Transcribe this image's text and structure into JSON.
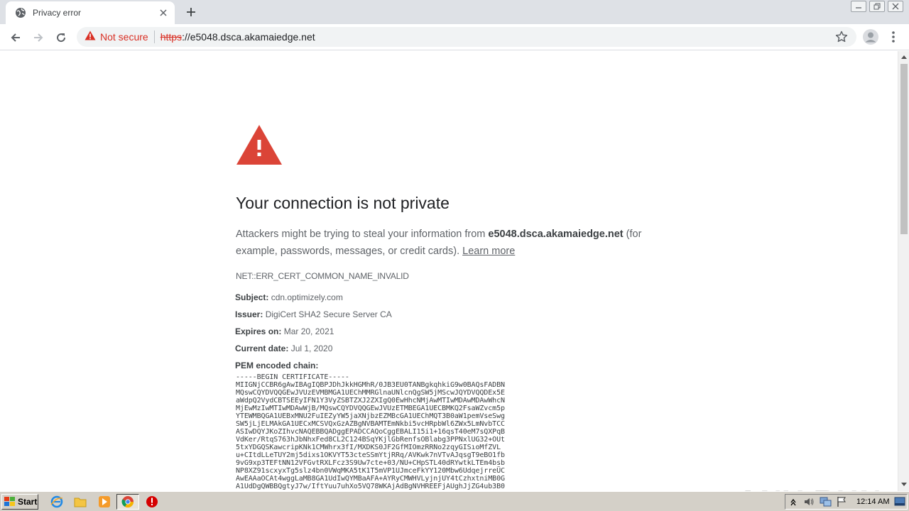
{
  "tab": {
    "title": "Privacy error"
  },
  "omnibox": {
    "security_label": "Not secure",
    "url_scheme": "https",
    "url_rest": "://e5048.dsca.akamaiedge.net"
  },
  "page": {
    "heading": "Your connection is not private",
    "para_prefix": "Attackers might be trying to steal your information from ",
    "domain": "e5048.dsca.akamaiedge.net",
    "para_suffix": " (for example, passwords, messages, or credit cards). ",
    "learn_more": "Learn more",
    "error_code": "NET::ERR_CERT_COMMON_NAME_INVALID",
    "subject_key": "Subject:",
    "subject_value": "cdn.optimizely.com",
    "issuer_key": "Issuer:",
    "issuer_value": "DigiCert SHA2 Secure Server CA",
    "expires_key": "Expires on:",
    "expires_value": "Mar 20, 2021",
    "current_key": "Current date:",
    "current_value": "Jul 1, 2020",
    "pem_key": "PEM encoded chain:",
    "pem_text": "-----BEGIN CERTIFICATE-----\nMIIGNjCCBR6gAwIBAgIQBPJDhJkkHGMhR/0JB3EU0TANBgkqhkiG9w0BAQsFADBN\nMQswCQYDVQQGEwJVUzEVMBMGA1UEChMMRGlnaUNlcnQgSW5jMScwJQYDVQQDEx5E\naWdpQ2VydCBTSEEyIFN1Y3VyZSBTZXJ2ZXIgQ0EwHhcNMjAwMTIwMDAwMDAwWhcN\nMjEwMzIwMTIwMDAwWjB/MQswCQYDVQQGEwJVUzETMBEGA1UECBMKQ2FsaWZvcm5p\nYTEWMBQGA1UEBxMNU2FuIEZyYW5jaXNjbzEZMBcGA1UEChMQT3B0aW1pemVseSwg\nSW5jLjELMAkGA1UECxMCSVQxGzAZBgNVBAMTEmNkbi5vcHRpbWl6ZWx5LmNvbTCC\nASIwDQYJKoZIhvcNAQEBBQADggEPADCCAQoCggEBALI15i1+16qsT40eM7sQXPqB\nVdKer/RtqS763hJbNhxFed8CL2C124BSqYKjlGbRenfsOBlabg3PPNxlUG32+OUt\n5txYDGQSKawcripKNk1CMWhrx3fI/MXDKS0JF2GfMIOmzRRNo2zqyGISıoMfZVL\nu+CItdLLeTUY2mj5dixs1OKVYT53cteSSmYtjRRq/AVKwk7nVTvAJqsgT9eBO1fb\n9vG9xp3TEFtNN12VFGvtRXLFcz3S9Uw7cte+03/NU+CHpSTL40dRYwtkLTEm4bsb\nNP8XZ91scxyxTg5slz4bn0VWqMKA5tK1T5mVP1UJmceFkYY120Mbw6UdqejrreÜC\nAwEAAaOCAt4wggLaMB8GA1UdIwQYMBaAFA+AYRyCMWHVLyjnjUY4tCzhxtniMB0G\nA1UdDgQWBBQgtyJ7w/IftYuu7uhXo5VQ78WKAjAdBgNVHREEFjAUghJjZG4ub3B0"
  },
  "taskbar": {
    "start_label": "Start",
    "clock": "12:14 AM"
  },
  "watermark": "ANY RUN",
  "colors": {
    "danger": "#d93025",
    "warning_triangle": "#db4437",
    "text_secondary": "#5f6368"
  }
}
